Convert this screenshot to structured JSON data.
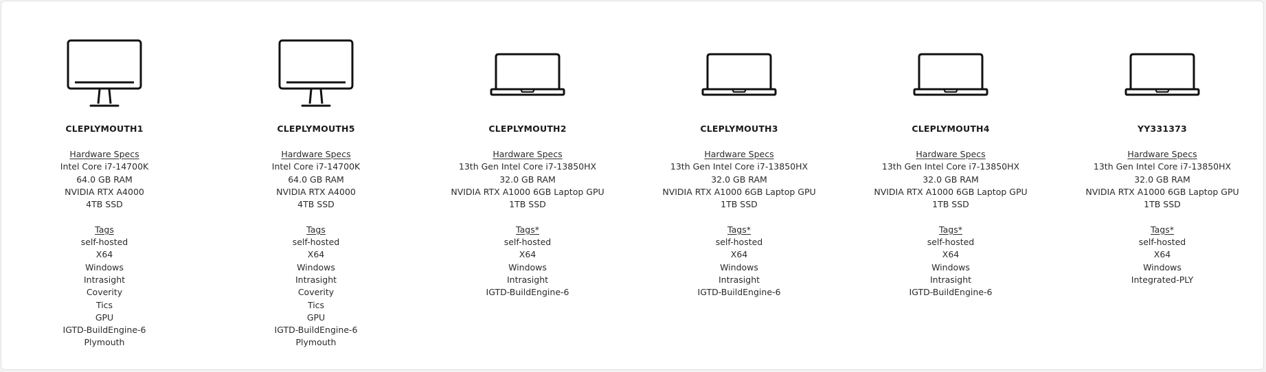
{
  "labels": {
    "hardware_heading": "Hardware Specs",
    "tags_heading": "Tags",
    "tags_heading_alt": "Tags*"
  },
  "machines": [
    {
      "icon": "desktop-monitor-icon",
      "name": "CLEPLYMOUTH1",
      "specs": [
        "Intel Core i7-14700K",
        "64.0 GB RAM",
        "NVIDIA RTX A4000",
        "4TB SSD"
      ],
      "tags_heading": "Tags",
      "tags": [
        "self-hosted",
        "X64",
        "Windows",
        "Intrasight",
        "Coverity",
        "Tics",
        "GPU",
        "IGTD-BuildEngine-6",
        "Plymouth"
      ]
    },
    {
      "icon": "desktop-monitor-icon",
      "name": "CLEPLYMOUTH5",
      "specs": [
        "Intel Core i7-14700K",
        "64.0 GB RAM",
        "NVIDIA RTX A4000",
        "4TB SSD"
      ],
      "tags_heading": "Tags",
      "tags": [
        "self-hosted",
        "X64",
        "Windows",
        "Intrasight",
        "Coverity",
        "Tics",
        "GPU",
        "IGTD-BuildEngine-6",
        "Plymouth"
      ]
    },
    {
      "icon": "laptop-icon",
      "name": "CLEPLYMOUTH2",
      "specs": [
        "13th Gen Intel Core i7-13850HX",
        "32.0 GB RAM",
        "NVIDIA RTX A1000 6GB Laptop GPU",
        "1TB SSD"
      ],
      "tags_heading": "Tags*",
      "tags": [
        "self-hosted",
        "X64",
        "Windows",
        "Intrasight",
        "IGTD-BuildEngine-6"
      ]
    },
    {
      "icon": "laptop-icon",
      "name": "CLEPLYMOUTH3",
      "specs": [
        "13th Gen Intel Core i7-13850HX",
        "32.0 GB RAM",
        "NVIDIA RTX A1000 6GB Laptop GPU",
        "1TB SSD"
      ],
      "tags_heading": "Tags*",
      "tags": [
        "self-hosted",
        "X64",
        "Windows",
        "Intrasight",
        "IGTD-BuildEngine-6"
      ]
    },
    {
      "icon": "laptop-icon",
      "name": "CLEPLYMOUTH4",
      "specs": [
        "13th Gen Intel Core i7-13850HX",
        "32.0 GB RAM",
        "NVIDIA RTX A1000 6GB Laptop GPU",
        "1TB SSD"
      ],
      "tags_heading": "Tags*",
      "tags": [
        "self-hosted",
        "X64",
        "Windows",
        "Intrasight",
        "IGTD-BuildEngine-6"
      ]
    },
    {
      "icon": "laptop-icon",
      "name": "YY331373",
      "specs": [
        "13th Gen Intel Core i7-13850HX",
        "32.0 GB RAM",
        "NVIDIA RTX A1000 6GB Laptop GPU",
        "1TB SSD"
      ],
      "tags_heading": "Tags*",
      "tags": [
        "self-hosted",
        "X64",
        "Windows",
        "Integrated-PLY"
      ]
    }
  ]
}
